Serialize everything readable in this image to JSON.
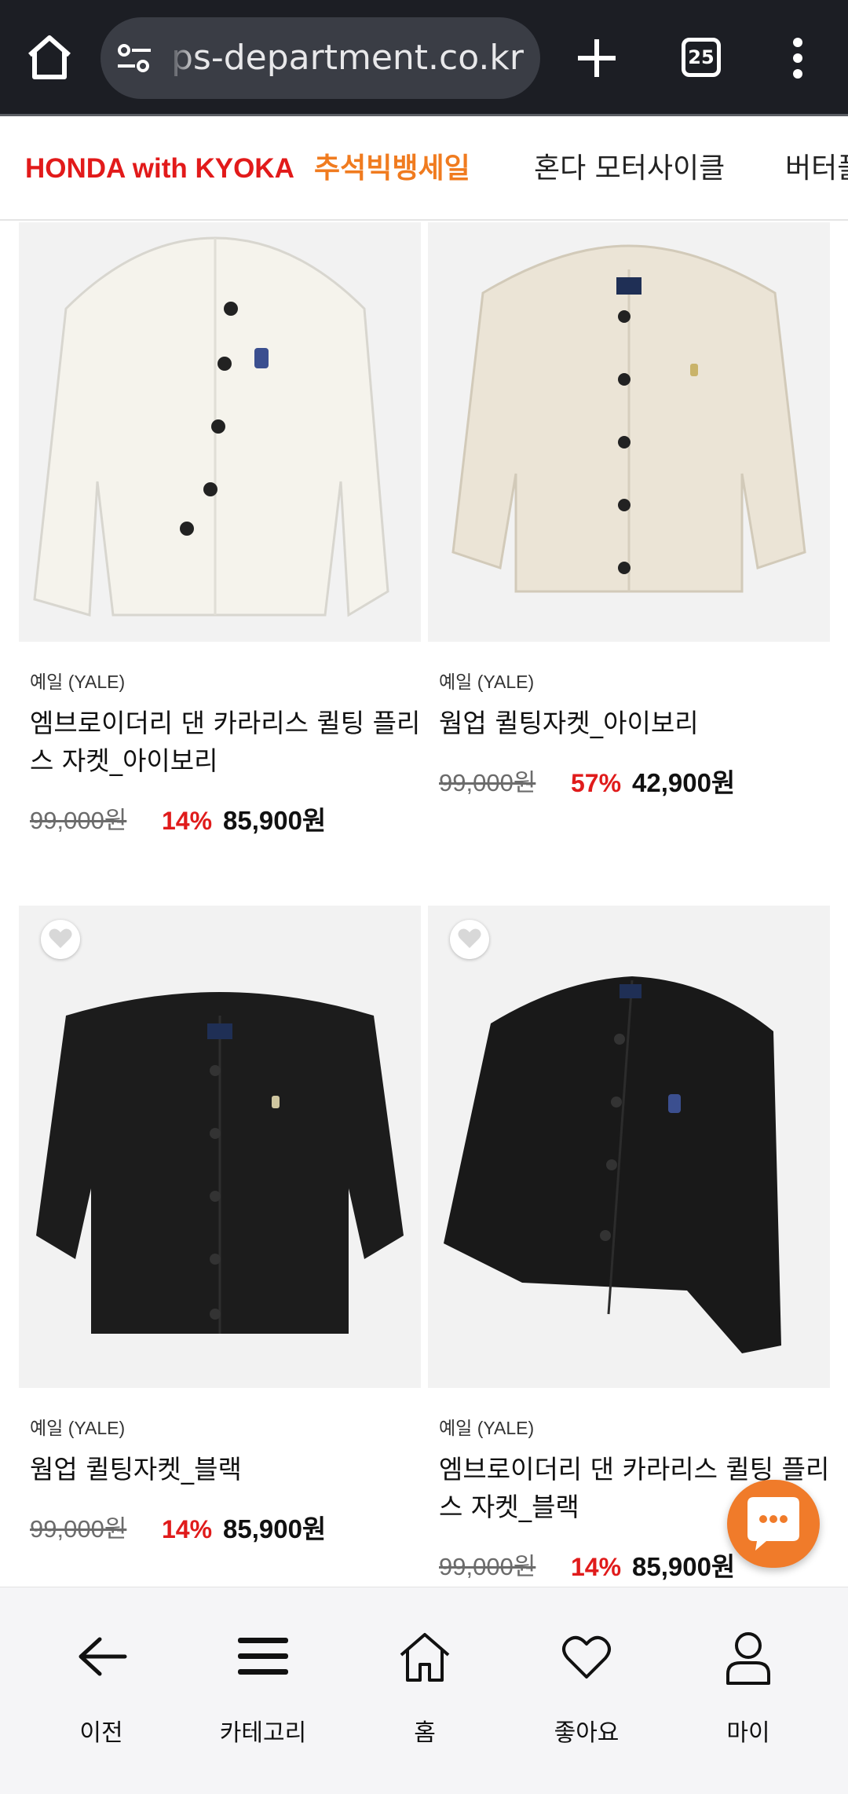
{
  "browser": {
    "url": "ps-department.co.kr",
    "tab_count": "25"
  },
  "categories": [
    {
      "label": "HONDA with KYOKA",
      "color": "#e21a1a"
    },
    {
      "label": "추석빅뱅세일",
      "color": "#f07b1f"
    },
    {
      "label": "혼다 모터사이클",
      "color": "#222222"
    },
    {
      "label": "버터플",
      "color": "#222222"
    }
  ],
  "products": [
    {
      "brand": "예일 (YALE)",
      "name": "엠브로이더리 댄 카라리스 퀼팅 플리스 자켓_아이보리",
      "original_price": "99,000원",
      "discount": "14%",
      "sale_price": "85,900원",
      "jacket_color": "#f4f2ea"
    },
    {
      "brand": "예일 (YALE)",
      "name": "웜업 퀼팅자켓_아이보리",
      "original_price": "99,000원",
      "discount": "57%",
      "sale_price": "42,900원",
      "jacket_color": "#e9e2d4"
    },
    {
      "brand": "예일 (YALE)",
      "name": "웜업 퀼팅자켓_블랙",
      "original_price": "99,000원",
      "discount": "14%",
      "sale_price": "85,900원",
      "jacket_color": "#1b1b1b"
    },
    {
      "brand": "예일 (YALE)",
      "name": "엠브로이더리 댄 카라리스 퀼팅 플리스 자켓_블랙",
      "original_price": "99,000원",
      "discount": "14%",
      "sale_price": "85,900원",
      "jacket_color": "#1a1a1a"
    }
  ],
  "bottom_nav": [
    {
      "label": "이전",
      "icon": "back-arrow-icon"
    },
    {
      "label": "카테고리",
      "icon": "hamburger-menu-icon"
    },
    {
      "label": "홈",
      "icon": "home-icon"
    },
    {
      "label": "좋아요",
      "icon": "heart-icon"
    },
    {
      "label": "마이",
      "icon": "user-icon"
    }
  ],
  "colors": {
    "accent": "#f07b2a",
    "discount": "#e01b1b",
    "brand_red": "#e21a1a"
  }
}
